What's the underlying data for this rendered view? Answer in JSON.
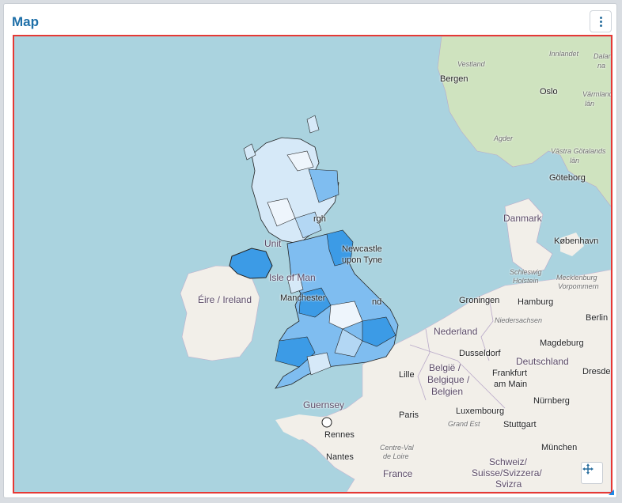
{
  "card": {
    "title": "Map"
  },
  "colors": {
    "sea": "#aad3df",
    "land": "#f2efe9",
    "forest": "#cfe3bf",
    "choropleth_dark": "#3c9be6",
    "choropleth_mid": "#7fbdf0",
    "choropleth_light": "#d6e9f8",
    "frame_border": "#e53935",
    "title": "#1e6fa8"
  },
  "icons": {
    "menu": "kebab-vertical-icon",
    "expand": "move-arrows-icon"
  },
  "labels": {
    "bergen": "Bergen",
    "oslo": "Oslo",
    "vestland": "Vestland",
    "agder": "Agder",
    "innlandet": "Innlandet",
    "varmlands": "Värmlands",
    "lan": "län",
    "dalarna": "Dalar",
    "dalarna_2": "na",
    "vastra_gotaland": "Västra Götalands",
    "vastra_gotaland_2": "län",
    "goteborg": "Göteborg",
    "danmark": "Danmark",
    "kobenhavn": "København",
    "schleswig": "Schleswig",
    "holstein": "Holstein",
    "mecklenburg": "Mecklenburg",
    "vorpommern": "Vorpommern",
    "hamburg": "Hamburg",
    "groningen": "Groningen",
    "nedersachsen": "Niedersachsen",
    "berlin": "Berlin",
    "nederland": "Nederland",
    "magdeburg": "Magdeburg",
    "dusseldorf": "Dusseldorf",
    "deutschland": "Deutschland",
    "dresden": "Dresde",
    "belgie_1": "België /",
    "belgie_2": "Belgique /",
    "belgie_3": "Belgien",
    "lille": "Lille",
    "frankfurt_1": "Frankfurt",
    "frankfurt_2": "am Main",
    "luxembourg": "Luxembourg",
    "nurnberg": "Nürnberg",
    "paris": "Paris",
    "grand_est": "Grand Est",
    "stuttgart": "Stuttgart",
    "munchen": "München",
    "guernsey": "Guernsey",
    "rennes": "Rennes",
    "nantes": "Nantes",
    "centre_1": "Centre-Val",
    "centre_2": "de Loire",
    "france": "France",
    "schweiz_1": "Schweiz/",
    "schweiz_2": "Suisse/Svizzera/",
    "schweiz_3": "Svizra",
    "eire": "Éire / Ireland",
    "manchester": "Manchester",
    "newcastle_1": "Newcastle",
    "newcastle_2": "upon Tyne",
    "united": "Unit",
    "isle_of_man": "Isle of Man",
    "edinburgh": "rgh",
    "england": "nd"
  }
}
